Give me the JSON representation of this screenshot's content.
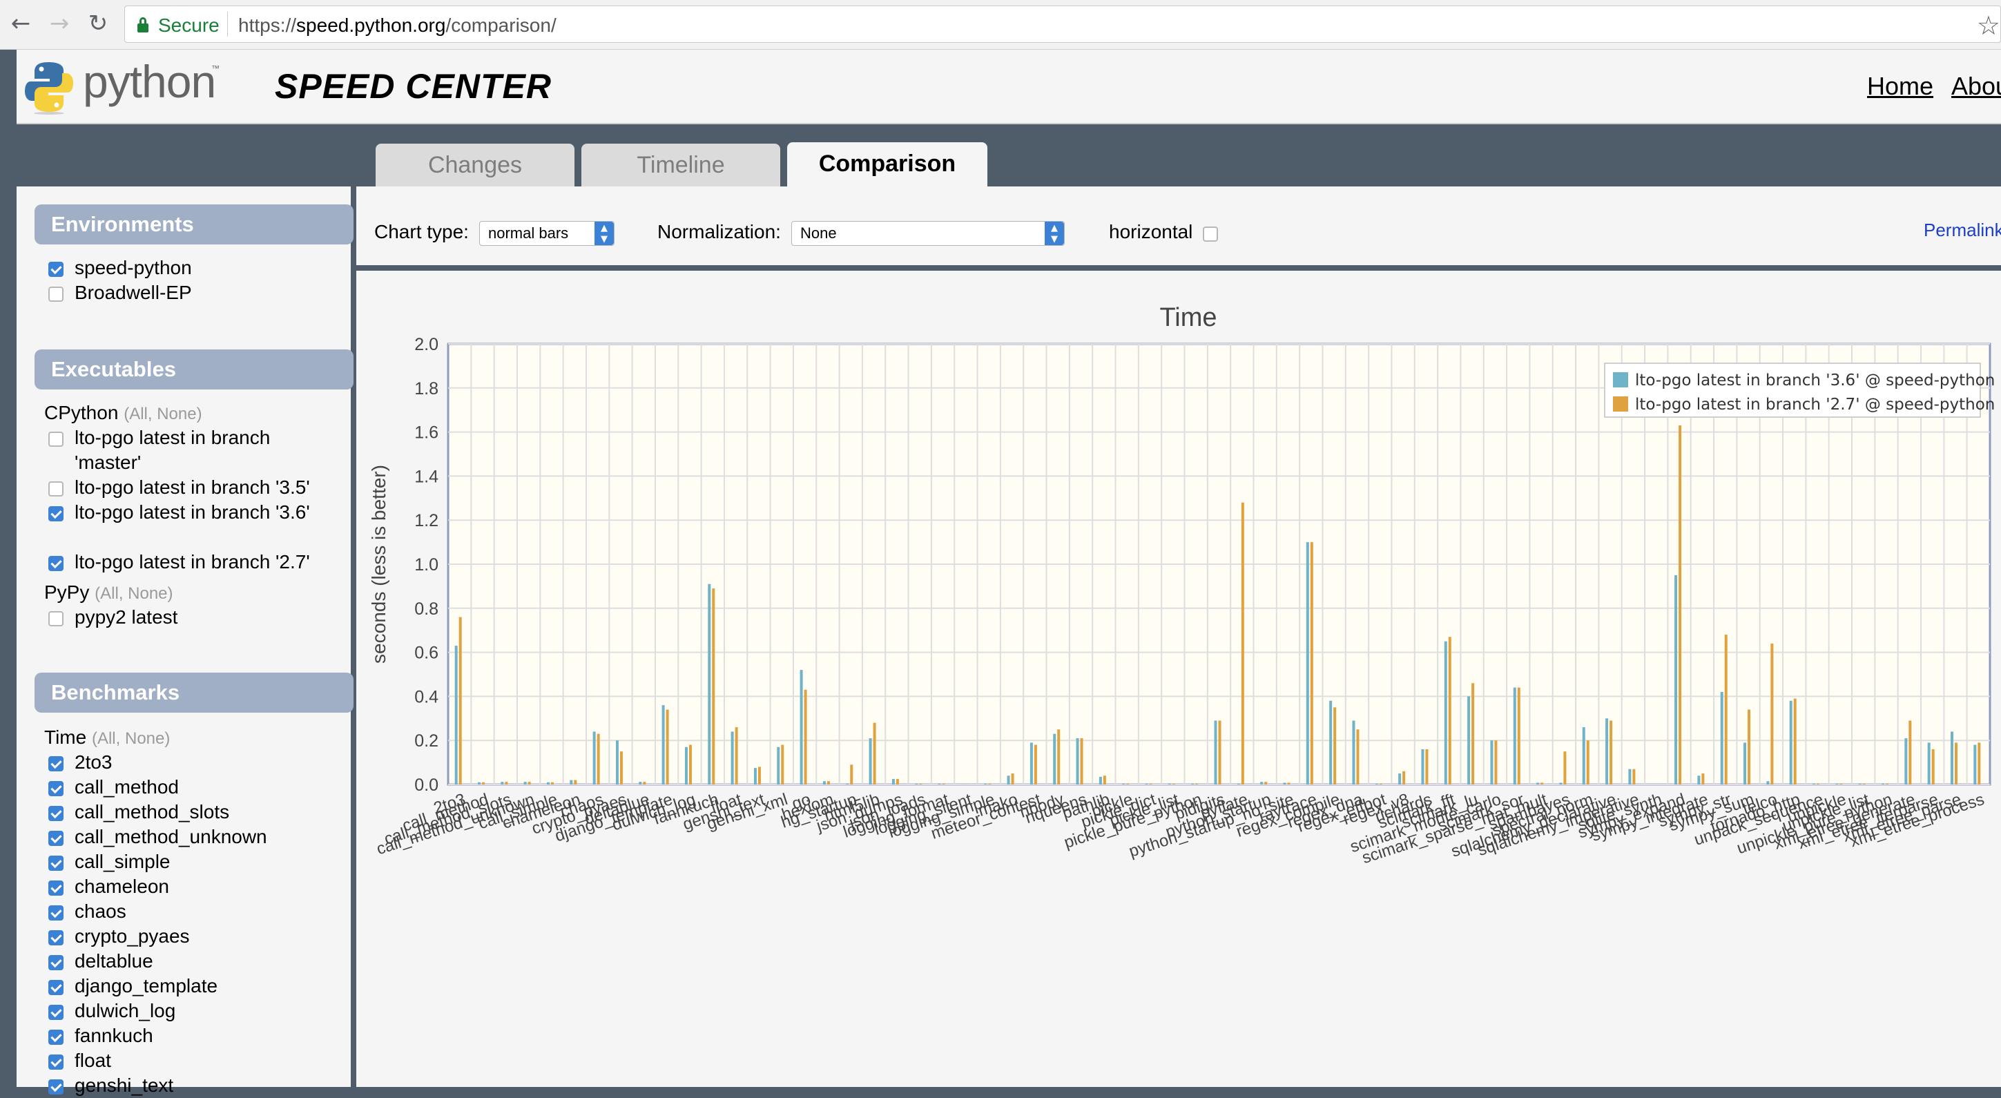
{
  "browser": {
    "secure_label": "Secure",
    "url_scheme": "https://",
    "url_host": "speed.python.org",
    "url_path": "/comparison/"
  },
  "header": {
    "logo_text": "python",
    "logo_tm": "™",
    "title": "SPEED CENTER",
    "nav": [
      "Home",
      "Abou"
    ]
  },
  "tabs": [
    {
      "label": "Changes",
      "active": false
    },
    {
      "label": "Timeline",
      "active": false
    },
    {
      "label": "Comparison",
      "active": true
    }
  ],
  "sidebar": {
    "environments": {
      "title": "Environments",
      "items": [
        {
          "label": "speed-python",
          "checked": true
        },
        {
          "label": "Broadwell-EP",
          "checked": false
        }
      ]
    },
    "executables": {
      "title": "Executables",
      "groups": [
        {
          "name": "CPython",
          "all": "All",
          "none": "None",
          "items": [
            {
              "label": "lto-pgo latest in branch 'master'",
              "checked": false
            },
            {
              "label": "lto-pgo latest in branch '3.5'",
              "checked": false
            },
            {
              "label": "lto-pgo latest in branch '3.6'",
              "checked": true
            },
            {
              "label": "lto-pgo latest in branch '2.7'",
              "checked": true
            }
          ]
        },
        {
          "name": "PyPy",
          "all": "All",
          "none": "None",
          "items": [
            {
              "label": "pypy2 latest",
              "checked": false
            }
          ]
        }
      ]
    },
    "benchmarks": {
      "title": "Benchmarks",
      "group": "Time",
      "all": "All",
      "none": "None",
      "items": [
        "2to3",
        "call_method",
        "call_method_slots",
        "call_method_unknown",
        "call_simple",
        "chameleon",
        "chaos",
        "crypto_pyaes",
        "deltablue",
        "django_template",
        "dulwich_log",
        "fannkuch",
        "float",
        "genshi_text"
      ]
    }
  },
  "controls": {
    "chart_type_label": "Chart type:",
    "chart_type_value": "normal bars",
    "normalization_label": "Normalization:",
    "normalization_value": "None",
    "horizontal_label": "horizontal",
    "horizontal_checked": false,
    "permalink": "Permalink"
  },
  "colors": {
    "series_36": "#6fb3c9",
    "series_27": "#e0a23e",
    "header_box": "#a0aec6",
    "checkbox": "#3b82d6"
  },
  "chart_data": {
    "type": "bar",
    "title": "Time",
    "ylabel": "seconds (less is better)",
    "ylim": [
      0,
      2.0
    ],
    "yticks": [
      "0.0",
      "0.2",
      "0.4",
      "0.6",
      "0.8",
      "1.0",
      "1.2",
      "1.4",
      "1.6",
      "1.8",
      "2.0"
    ],
    "legend_position": "top-right",
    "grid": true,
    "categories": [
      "2to3",
      "call_method",
      "call_method_slots",
      "call_method_unknown",
      "call_simple",
      "chameleon",
      "chaos",
      "crypto_pyaes",
      "deltablue",
      "django_template",
      "dulwich_log",
      "fannkuch",
      "float",
      "genshi_text",
      "genshi_xml",
      "go",
      "hexiom",
      "hg_startup",
      "html5lib",
      "json_dumps",
      "json_loads",
      "logging_format",
      "logging_silent",
      "logging_simple",
      "mako",
      "meteor_contest",
      "nbody",
      "nqueens",
      "pathlib",
      "pickle",
      "pickle_dict",
      "pickle_list",
      "pickle_pure_python",
      "pidigits",
      "pyflate",
      "python_startup",
      "python_startup_no_site",
      "raytrace",
      "regex_compile",
      "regex_dna",
      "regex_effbot",
      "regex_v8",
      "richards",
      "scimark_fft",
      "scimark_lu",
      "scimark_monte_carlo",
      "scimark_sor",
      "scimark_sparse_mat_mult",
      "spambayes",
      "spectral_norm",
      "sqlalchemy_declarative",
      "sqlalchemy_imperative",
      "sqlite_synth",
      "sympy_expand",
      "sympy_integrate",
      "sympy_str",
      "sympy_sum",
      "telco",
      "tornado_http",
      "unpack_sequence",
      "unpickle",
      "unpickle_list",
      "unpickle_pure_python",
      "xml_etree_generate",
      "xml_etree_iterparse",
      "xml_etree_parse",
      "xml_etree_process"
    ],
    "series": [
      {
        "name": "lto-pgo latest in branch '3.6' @ speed-python",
        "values": [
          0.63,
          0.01,
          0.012,
          0.012,
          0.01,
          0.02,
          0.24,
          0.2,
          0.012,
          0.36,
          0.17,
          0.91,
          0.24,
          0.075,
          0.17,
          0.52,
          0.015,
          0.003,
          0.21,
          0.025,
          0.003,
          0.003,
          0.0005,
          0.003,
          0.04,
          0.19,
          0.23,
          0.21,
          0.035,
          0.003,
          0.003,
          0.003,
          0.003,
          0.29,
          0.003,
          0.012,
          0.008,
          1.1,
          0.38,
          0.29,
          0.004,
          0.05,
          0.16,
          0.65,
          0.4,
          0.2,
          0.44,
          0.008,
          0.008,
          0.26,
          0.3,
          0.07,
          0.0,
          0.95,
          0.04,
          0.42,
          0.19,
          0.015,
          0.38,
          0.003,
          0.003,
          0.003,
          0.003,
          0.21,
          0.19,
          0.24,
          0.18
        ]
      },
      {
        "name": "lto-pgo latest in branch '2.7' @ speed-python",
        "values": [
          0.76,
          0.01,
          0.012,
          0.012,
          0.01,
          0.02,
          0.23,
          0.15,
          0.012,
          0.34,
          0.18,
          0.89,
          0.26,
          0.08,
          0.18,
          0.43,
          0.015,
          0.09,
          0.28,
          0.025,
          0.003,
          0.003,
          0.0005,
          0.003,
          0.05,
          0.18,
          0.25,
          0.21,
          0.04,
          0.003,
          0.003,
          0.003,
          0.003,
          0.29,
          1.28,
          0.012,
          0.008,
          1.1,
          0.35,
          0.25,
          0.004,
          0.06,
          0.16,
          0.67,
          0.46,
          0.2,
          0.44,
          0.008,
          0.15,
          0.2,
          0.29,
          0.07,
          0.0,
          1.63,
          0.05,
          0.68,
          0.34,
          0.64,
          0.39,
          0.003,
          0.003,
          0.003,
          0.003,
          0.29,
          0.16,
          0.19,
          0.19
        ]
      }
    ]
  }
}
